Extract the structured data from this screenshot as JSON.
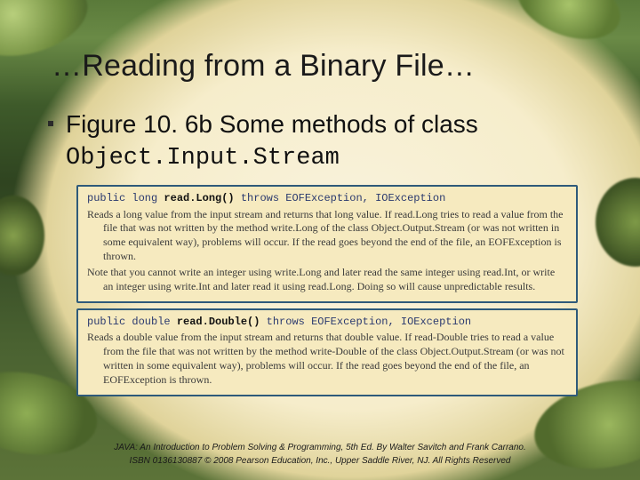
{
  "title": "…Reading from a Binary File…",
  "bullet": {
    "lead": "Figure 10. 6b  Some methods of class",
    "code": "Object.Input.Stream"
  },
  "panels": [
    {
      "sig_pre": "public long ",
      "sig_method": "read.Long()",
      "sig_post": " throws EOFException, IOException",
      "desc": [
        "Reads a long value from the input stream and returns that long value. If read.Long tries to read a value from the file that was not written by the method write.Long of the class Object.Output.Stream (or was not written in some equivalent way), problems will occur. If the read goes beyond the end of the file, an EOFException is thrown.",
        "Note that you cannot write an integer using write.Long and later read the same integer using read.Int, or write an integer using write.Int and later read it using read.Long. Doing so will cause unpredictable results."
      ]
    },
    {
      "sig_pre": "public double ",
      "sig_method": "read.Double()",
      "sig_post": " throws EOFException, IOException",
      "desc": [
        "Reads a double value from the input stream and returns that double value. If read-Double tries to read a value from the file that was not written by the method write-Double of the class Object.Output.Stream (or was not written in some equivalent way), problems will occur. If the read goes beyond the end of the file, an EOFException is thrown."
      ]
    }
  ],
  "footer": {
    "line1": "JAVA: An Introduction to Problem Solving & Programming, 5th Ed. By Walter Savitch and Frank Carrano.",
    "line2": "ISBN 0136130887 © 2008 Pearson Education, Inc., Upper Saddle River, NJ. All Rights Reserved"
  }
}
